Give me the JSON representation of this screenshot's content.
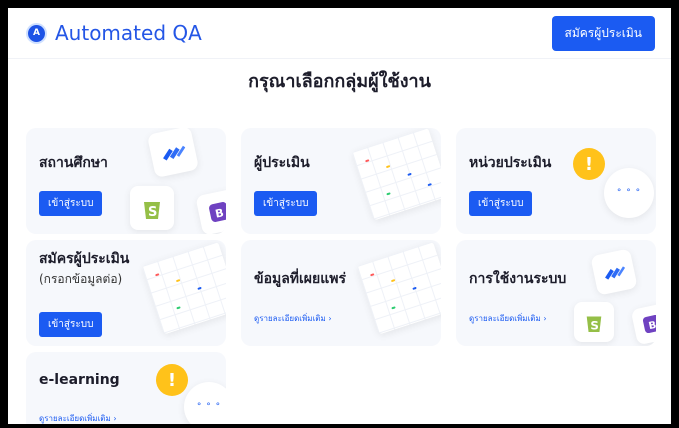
{
  "header": {
    "brand_name": "Automated QA",
    "register_button": "สมัครผู้ประเมิน"
  },
  "page_title": "กรุณาเลือกกลุ่มผู้ใช้งาน",
  "cards": [
    {
      "title": "สถานศึกษา",
      "button": "เข้าสู่ระบบ"
    },
    {
      "title": "ผู้ประเมิน",
      "button": "เข้าสู่ระบบ"
    },
    {
      "title": "หน่วยประเมิน",
      "button": "เข้าสู่ระบบ"
    },
    {
      "title": "สมัครผู้ประเมิน",
      "subtitle": "(กรอกข้อมูลต่อ)",
      "button": "เข้าสู่ระบบ"
    },
    {
      "title": "ข้อมูลที่เผยแพร่",
      "link": "ดูรายละเอียดเพิ่มเติม ›"
    },
    {
      "title": "การใช้งานระบบ",
      "link": "ดูรายละเอียดเพิ่มเติม ›"
    },
    {
      "title": "e-learning",
      "link": "ดูรายละเอียดเพิ่มเติม ›"
    }
  ],
  "icons": {
    "brand": "app-logo-icon",
    "jira": "jira-chevron-icon",
    "shopify": "shopify-bag-icon",
    "bootstrap": "bootstrap-icon",
    "alert": "exclamation-bubble-icon",
    "chat": "chat-bubble-icon"
  },
  "colors": {
    "accent": "#1b5bf2",
    "brand_text": "#2456e6",
    "card_bg": "#f6f8fc",
    "alert_yellow": "#ffc21a",
    "shopify_green": "#95bf47",
    "bootstrap_purple": "#6f42c1"
  }
}
